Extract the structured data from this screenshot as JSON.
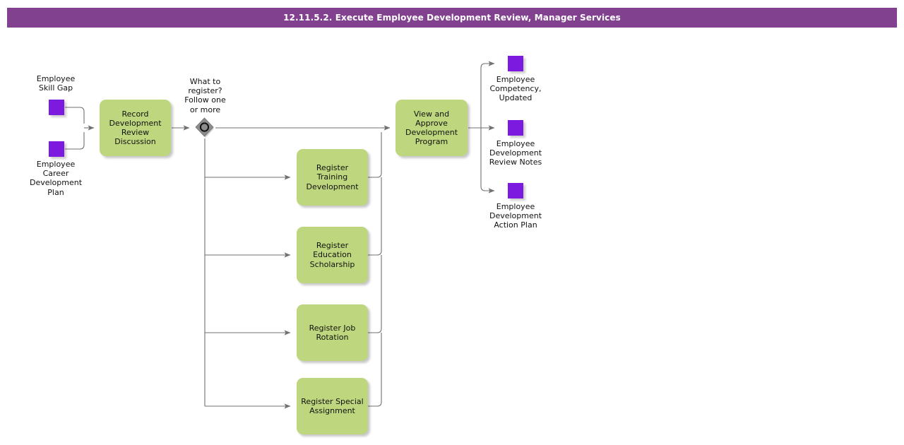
{
  "header": {
    "title": "12.11.5.2. Execute Employee Development Review, Manager Services",
    "bar_color": "#82418F",
    "text_color": "#FFFFFF"
  },
  "palette": {
    "task_fill": "#BED67E",
    "data_object_fill": "#7D1AE0",
    "connector_stroke": "#717171",
    "gateway_fill": "#808080",
    "text": "#11120F"
  },
  "diagram": {
    "type": "bpmn-process-flow",
    "inputs": [
      {
        "id": "employee-skill-gap",
        "label": "Employee\nSkill Gap",
        "icon": "data-object-icon"
      },
      {
        "id": "employee-career-development-plan",
        "label": "Employee\nCareer\nDevelopment\nPlan",
        "icon": "data-object-icon"
      }
    ],
    "gateway": {
      "id": "what-to-register-gateway",
      "kind": "inclusive-or-gateway",
      "label": "What to\nregister?\nFollow one\nor more"
    },
    "tasks": [
      {
        "id": "record-development-review-discussion",
        "label": "Record\nDevelopment\nReview\nDiscussion"
      },
      {
        "id": "register-training-development",
        "label": "Register\nTraining\nDevelopment"
      },
      {
        "id": "register-education-scholarship",
        "label": "Register\nEducation\nScholarship"
      },
      {
        "id": "register-job-rotation",
        "label": "Register Job\nRotation"
      },
      {
        "id": "register-special-assignment",
        "label": "Register Special\nAssignment"
      },
      {
        "id": "view-and-approve-development-program",
        "label": "View and\nApprove\nDevelopment\nProgram"
      }
    ],
    "outputs": [
      {
        "id": "employee-competency-updated",
        "label": "Employee\nCompetency,\nUpdated",
        "icon": "data-object-icon"
      },
      {
        "id": "employee-development-review-notes",
        "label": "Employee\nDevelopment\nReview Notes",
        "icon": "data-object-icon"
      },
      {
        "id": "employee-development-action-plan",
        "label": "Employee\nDevelopment\nAction Plan",
        "icon": "data-object-icon"
      }
    ]
  }
}
